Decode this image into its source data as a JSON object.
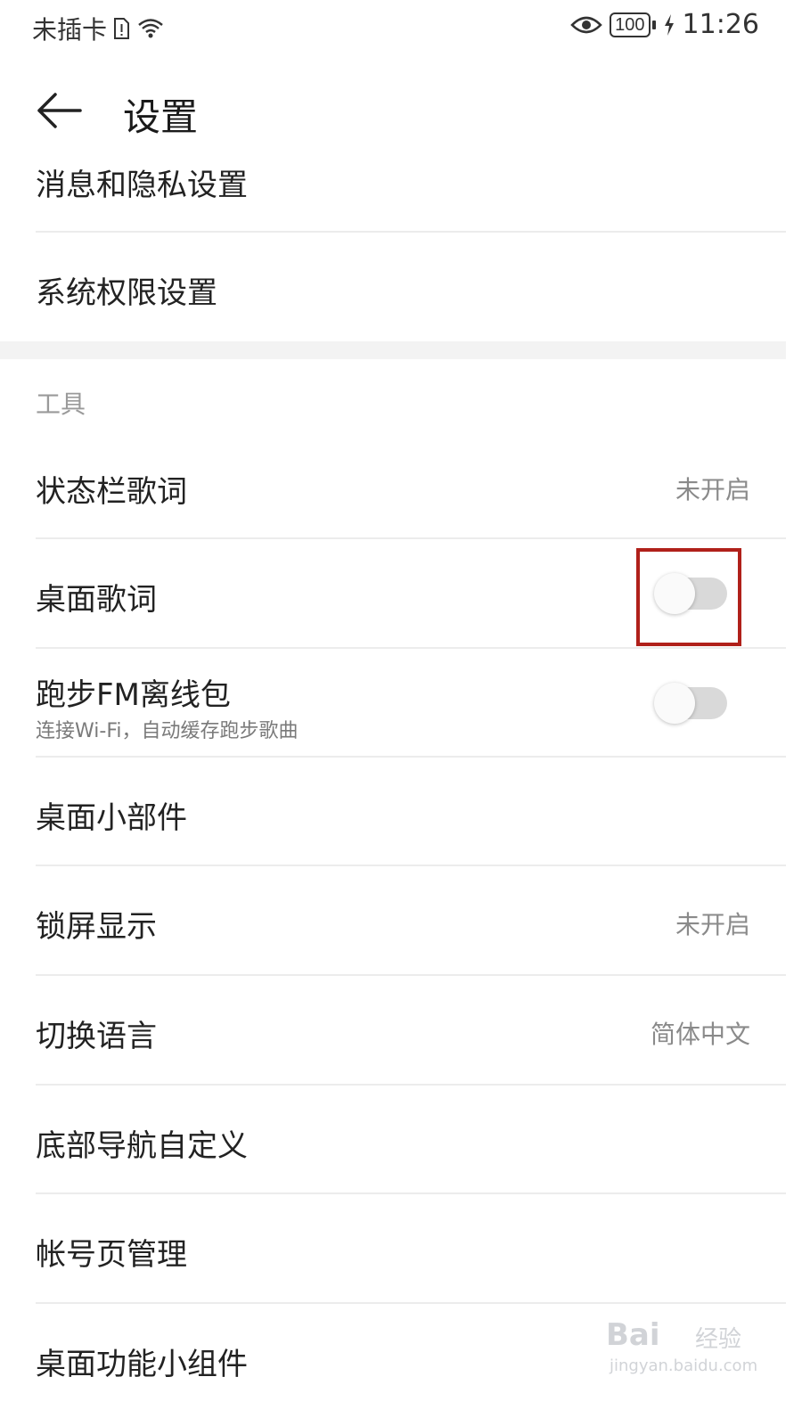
{
  "status_bar": {
    "carrier": "未插卡",
    "time": "11:26",
    "battery": "100"
  },
  "header": {
    "title": "设置"
  },
  "items_top": [
    {
      "label": "消息和隐私设置"
    },
    {
      "label": "系统权限设置"
    }
  ],
  "tools_section": {
    "title": "工具",
    "status_bar_lyrics": {
      "label": "状态栏歌词",
      "value": "未开启"
    },
    "desktop_lyrics": {
      "label": "桌面歌词",
      "toggle_on": false
    },
    "running_fm": {
      "label": "跑步FM离线包",
      "subtitle": "连接Wi-Fi，自动缓存跑步歌曲",
      "toggle_on": false
    },
    "desktop_widget": {
      "label": "桌面小部件"
    },
    "lock_screen": {
      "label": "锁屏显示",
      "value": "未开启"
    },
    "language": {
      "label": "切换语言",
      "value": "简体中文"
    },
    "bottom_nav": {
      "label": "底部导航自定义"
    },
    "account_page": {
      "label": "帐号页管理"
    },
    "desktop_function_widget": {
      "label": "桌面功能小组件"
    }
  },
  "watermark": {
    "logo": "Bai",
    "text": "经验",
    "url": "jingyan.baidu.com"
  },
  "colors": {
    "highlight": "#b0201a",
    "toggle_track": "#d9d9d9",
    "divider": "#ececec"
  }
}
